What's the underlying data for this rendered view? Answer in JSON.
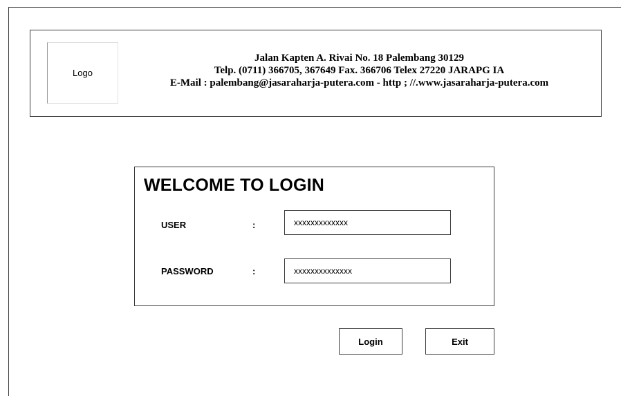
{
  "header": {
    "logo_label": "Logo",
    "address_line": "Jalan Kapten A. Rivai No. 18 Palembang 30129",
    "phone_line": "Telp. (0711) 366705, 367649  Fax. 366706  Telex 27220  JARAPG IA",
    "contact_line": "E-Mail : palembang@jasaraharja-putera.com  -  http ; //.www.jasaraharja-putera.com"
  },
  "login": {
    "title": "WELCOME TO LOGIN",
    "user_label": "USER",
    "user_colon": ":",
    "user_value": "xxxxxxxxxxxxx",
    "password_label": "PASSWORD",
    "password_colon": ":",
    "password_value": "xxxxxxxxxxxxxx"
  },
  "actions": {
    "login_label": "Login",
    "exit_label": "Exit"
  }
}
